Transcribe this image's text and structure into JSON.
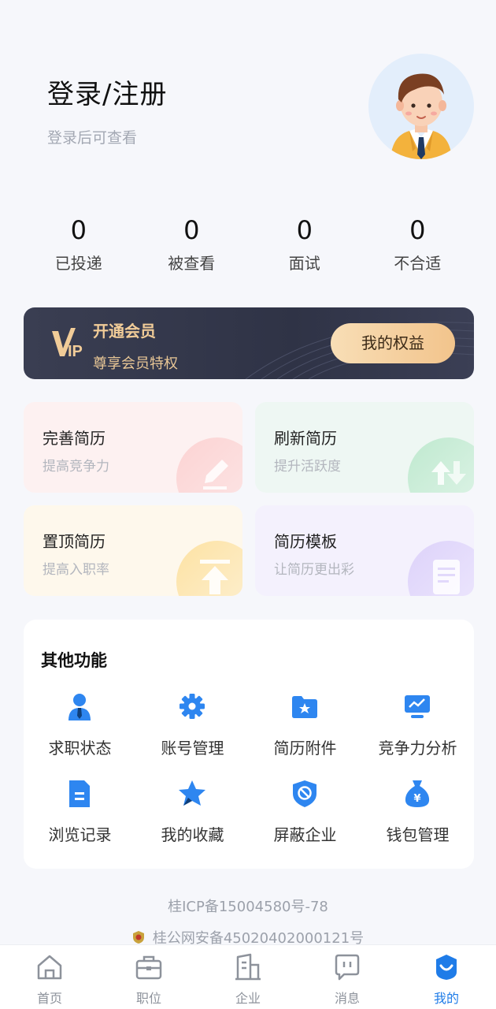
{
  "profile": {
    "login_title": "登录/注册",
    "login_subtitle": "登录后可查看"
  },
  "stats": [
    {
      "value": "0",
      "label": "已投递"
    },
    {
      "value": "0",
      "label": "被查看"
    },
    {
      "value": "0",
      "label": "面试"
    },
    {
      "value": "0",
      "label": "不合适"
    }
  ],
  "vip": {
    "logo_text": "IP",
    "title": "开通会员",
    "subtitle": "尊享会员特权",
    "button": "我的权益"
  },
  "resume_cards": [
    {
      "title": "完善简历",
      "subtitle": "提高竞争力",
      "icon": "pencil-icon"
    },
    {
      "title": "刷新简历",
      "subtitle": "提升活跃度",
      "icon": "refresh-icon"
    },
    {
      "title": "置顶简历",
      "subtitle": "提高入职率",
      "icon": "top-arrow-icon"
    },
    {
      "title": "简历模板",
      "subtitle": "让简历更出彩",
      "icon": "document-icon"
    }
  ],
  "other_functions": {
    "title": "其他功能",
    "items": [
      {
        "label": "求职状态",
        "icon": "person-tie-icon"
      },
      {
        "label": "账号管理",
        "icon": "gear-icon"
      },
      {
        "label": "简历附件",
        "icon": "folder-star-icon"
      },
      {
        "label": "竞争力分析",
        "icon": "monitor-chart-icon"
      },
      {
        "label": "浏览记录",
        "icon": "file-icon"
      },
      {
        "label": "我的收藏",
        "icon": "star-icon"
      },
      {
        "label": "屏蔽企业",
        "icon": "shield-block-icon"
      },
      {
        "label": "钱包管理",
        "icon": "money-bag-icon"
      }
    ]
  },
  "footer": {
    "icp": "桂ICP备15004580号-78",
    "police": "桂公网安备45020402000121号"
  },
  "tabbar": {
    "active": "我的",
    "items": [
      {
        "label": "首页",
        "icon": "home-icon"
      },
      {
        "label": "职位",
        "icon": "briefcase-icon"
      },
      {
        "label": "企业",
        "icon": "building-icon"
      },
      {
        "label": "消息",
        "icon": "message-icon"
      },
      {
        "label": "我的",
        "icon": "profile-icon"
      }
    ]
  },
  "colors": {
    "accent": "#1f7ce8",
    "vip_bg": "#33374a",
    "vip_gold": "#f1cc98"
  }
}
